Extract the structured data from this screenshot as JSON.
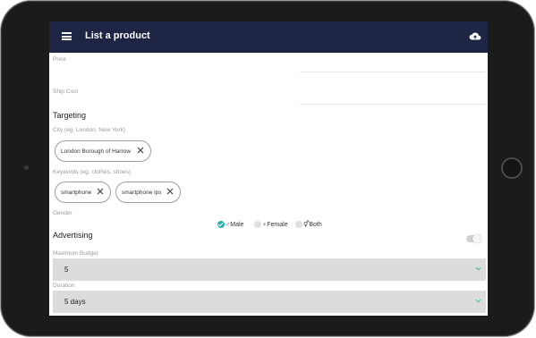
{
  "app": {
    "title": "List a product",
    "accent": "#1f2545",
    "teal": "#26b3a7"
  },
  "fields": {
    "price_label": "Price",
    "ship_cost_label": "Ship Cost"
  },
  "targeting": {
    "heading": "Targeting",
    "city_label": "City (eg. London, New York)",
    "city_chips": [
      "London Borough of Harrow"
    ],
    "keywords_label": "Keywords (eg. clothes, shoes)",
    "keyword_chips": [
      "smartphone",
      "smartphone ips"
    ],
    "gender_label": "Gender",
    "gender_options": [
      "♂Male",
      "♀Female",
      "⚥Both"
    ],
    "gender_selected": "♂Male"
  },
  "advertising": {
    "heading": "Advertising",
    "enabled": false,
    "budget_label": "Maximum Budget",
    "budget_value": "5",
    "duration_label": "Duration",
    "duration_value": "5 days"
  }
}
